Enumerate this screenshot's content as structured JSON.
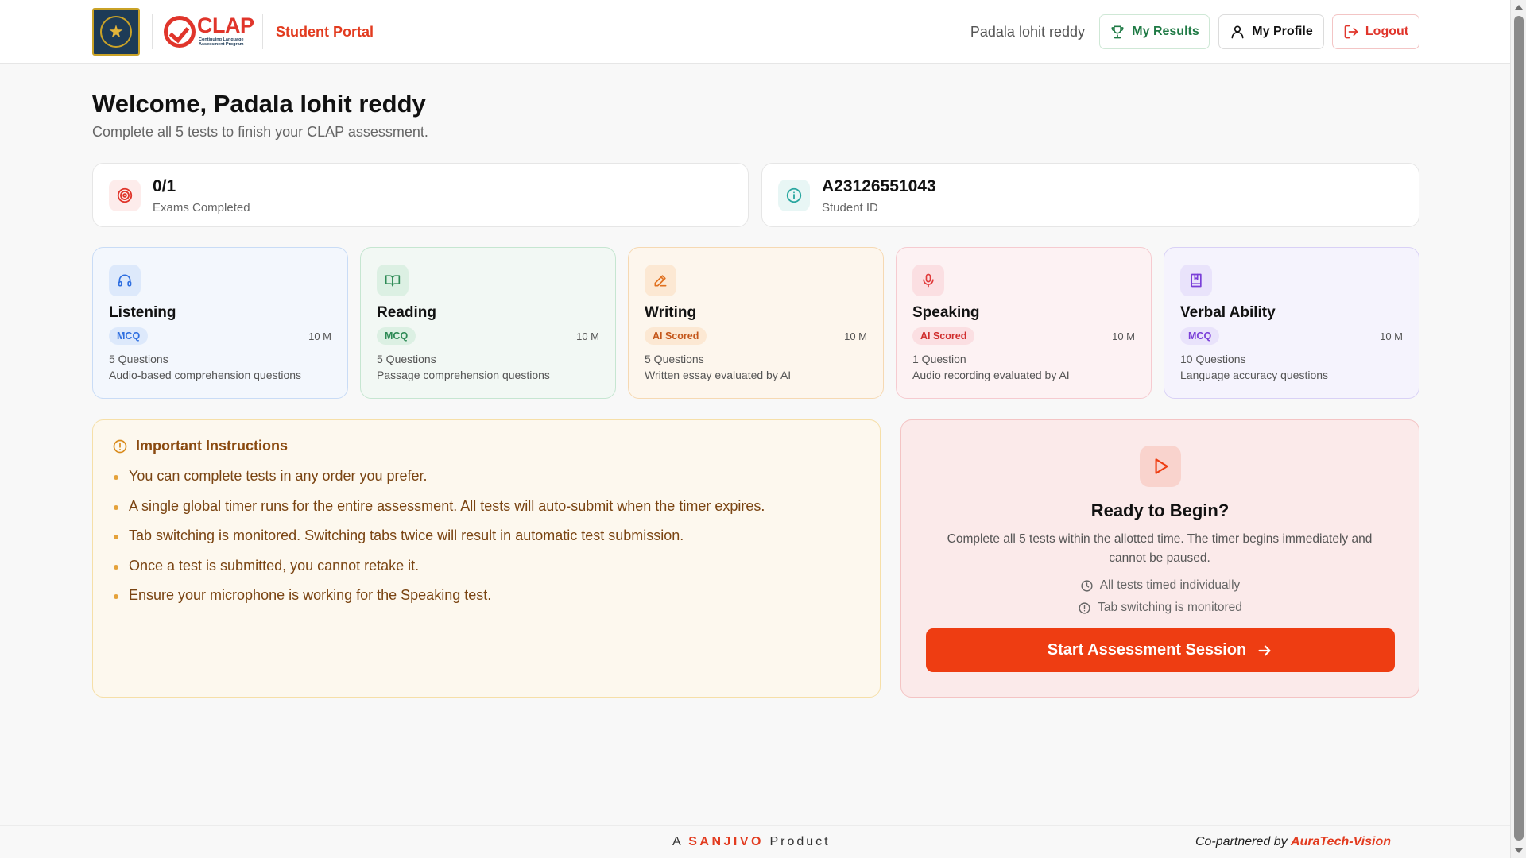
{
  "header": {
    "portal_title": "Student Portal",
    "clap_word": "CLAP",
    "clap_subtitle": "Continuing Language Assessment Program",
    "user_name": "Padala lohit reddy",
    "results_label": "My Results",
    "profile_label": "My Profile",
    "logout_label": "Logout"
  },
  "welcome": {
    "title": "Welcome, Padala lohit reddy",
    "subtitle": "Complete all 5 tests to finish your CLAP assessment."
  },
  "stats": {
    "exams_value": "0/1",
    "exams_label": "Exams Completed",
    "student_id_value": "A23126551043",
    "student_id_label": "Student ID"
  },
  "tests": [
    {
      "name": "Listening",
      "badge": "MCQ",
      "time": "10 M",
      "questions": "5 Questions",
      "description": "Audio-based comprehension questions",
      "icon": "headphones-icon"
    },
    {
      "name": "Reading",
      "badge": "MCQ",
      "time": "10 M",
      "questions": "5 Questions",
      "description": "Passage comprehension questions",
      "icon": "book-open-icon"
    },
    {
      "name": "Writing",
      "badge": "AI Scored",
      "time": "10 M",
      "questions": "5 Questions",
      "description": "Written essay evaluated by AI",
      "icon": "pencil-icon"
    },
    {
      "name": "Speaking",
      "badge": "AI Scored",
      "time": "10 M",
      "questions": "1 Question",
      "description": "Audio recording evaluated by AI",
      "icon": "microphone-icon"
    },
    {
      "name": "Verbal Ability",
      "badge": "MCQ",
      "time": "10 M",
      "questions": "10 Questions",
      "description": "Language accuracy questions",
      "icon": "bookmark-book-icon"
    }
  ],
  "instructions": {
    "title": "Important Instructions",
    "items": [
      "You can complete tests in any order you prefer.",
      "A single global timer runs for the entire assessment. All tests will auto-submit when the timer expires.",
      "Tab switching is monitored. Switching tabs twice will result in automatic test submission.",
      "Once a test is submitted, you cannot retake it.",
      "Ensure your microphone is working for the Speaking test."
    ]
  },
  "ready": {
    "title": "Ready to Begin?",
    "text": "Complete all 5 tests within the allotted time. The timer begins immediately and cannot be paused.",
    "note_timed": "All tests timed individually",
    "note_tabs": "Tab switching is monitored",
    "start_label": "Start Assessment Session"
  },
  "footer": {
    "brand_prefix": "A",
    "brand_name": "SANJIVO",
    "brand_suffix": "Product",
    "partner_prefix": "Co-partnered by",
    "partner_name": "AuraTech-Vision"
  },
  "colors": {
    "accent": "#ee3d12",
    "results_green": "#1f7a45",
    "logout_red": "#e0352b",
    "listening": "#2f6fe0",
    "reading": "#2d8a55",
    "writing": "#e0701f",
    "speaking": "#e03a3a",
    "verbal": "#7a3fd8"
  }
}
